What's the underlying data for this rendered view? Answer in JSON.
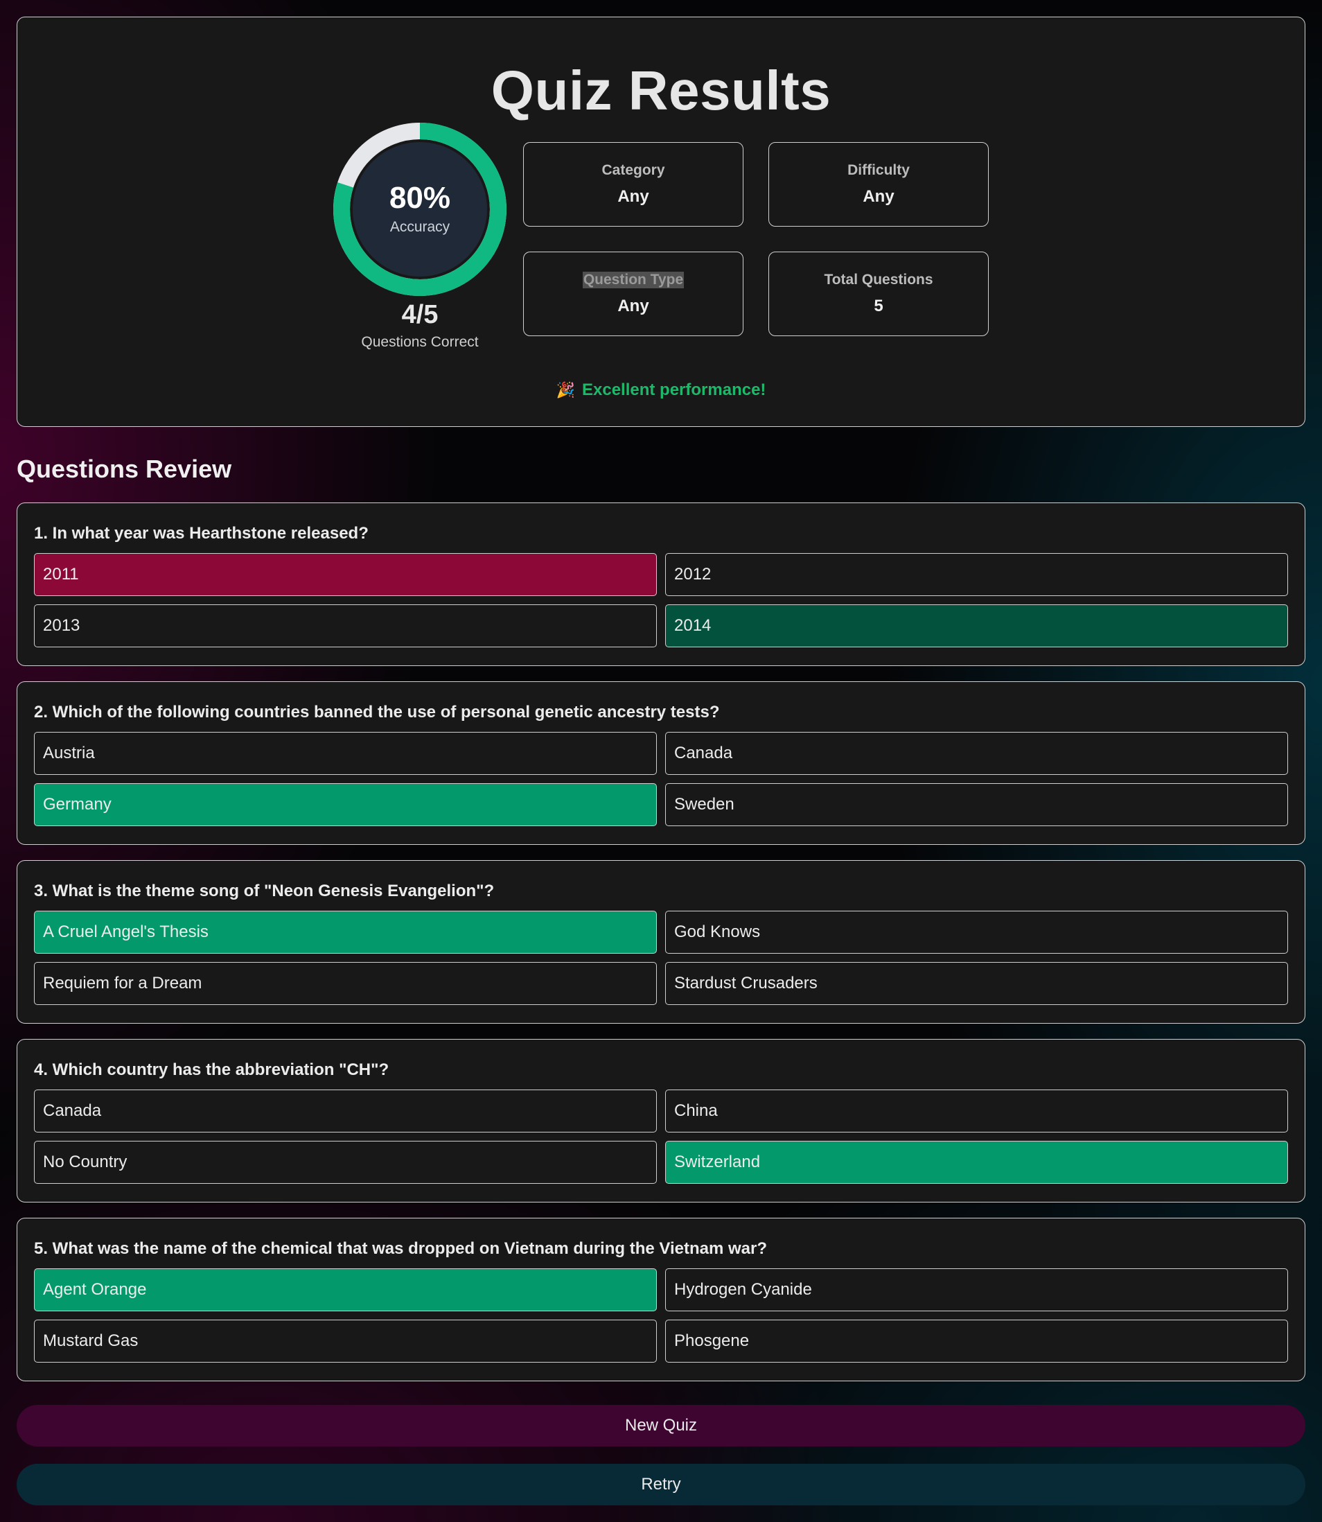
{
  "summary": {
    "title": "Quiz Results",
    "accuracy": {
      "value_text": "80%",
      "label": "Accuracy",
      "fraction": 0.8
    },
    "score": {
      "value": "4/5",
      "label": "Questions Correct"
    },
    "stats": {
      "category": {
        "label": "Category",
        "value": "Any"
      },
      "difficulty": {
        "label": "Difficulty",
        "value": "Any"
      },
      "question_type": {
        "label": "Question Type",
        "value": "Any"
      },
      "total_questions": {
        "label": "Total Questions",
        "value": "5"
      }
    },
    "performance": {
      "emoji": "🎉",
      "text": "Excellent performance!"
    }
  },
  "review": {
    "title": "Questions Review",
    "questions": [
      {
        "text": "1. In what year was Hearthstone released?",
        "answers": [
          "2011",
          "2012",
          "2013",
          "2014"
        ],
        "states": [
          "wrong",
          "",
          "",
          "answer"
        ]
      },
      {
        "text": "2. Which of the following countries banned the use of personal genetic ancestry tests?",
        "answers": [
          "Austria",
          "Canada",
          "Germany",
          "Sweden"
        ],
        "states": [
          "",
          "",
          "correct",
          ""
        ]
      },
      {
        "text": "3. What is the theme song of \"Neon Genesis Evangelion\"?",
        "answers": [
          "A Cruel Angel's Thesis",
          "God Knows",
          "Requiem for a Dream",
          "Stardust Crusaders"
        ],
        "states": [
          "correct",
          "",
          "",
          ""
        ]
      },
      {
        "text": "4. Which country has the abbreviation \"CH\"?",
        "answers": [
          "Canada",
          "China",
          "No Country",
          "Switzerland"
        ],
        "states": [
          "",
          "",
          "",
          "correct"
        ]
      },
      {
        "text": "5. What was the name of the chemical that was dropped on Vietnam during the Vietnam war?",
        "answers": [
          "Agent Orange",
          "Hydrogen Cyanide",
          "Mustard Gas",
          "Phosgene"
        ],
        "states": [
          "correct",
          "",
          "",
          ""
        ]
      }
    ]
  },
  "buttons": {
    "new_quiz": "New Quiz",
    "retry": "Retry"
  },
  "colors": {
    "accent_green": "#10b981",
    "correct": "#03996a",
    "wrong": "#8b0837",
    "right_answer": "#03523d",
    "new_quiz_bg": "#3e0530",
    "retry_bg": "#082a37"
  }
}
